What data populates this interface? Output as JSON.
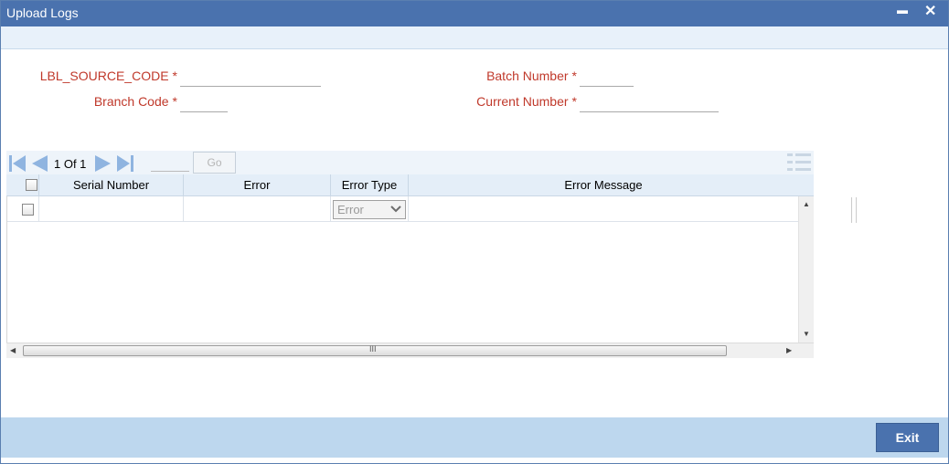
{
  "window": {
    "title": "Upload Logs",
    "minimize_glyph": "▬",
    "close_glyph": "✕"
  },
  "form": {
    "source_code_label": "LBL_SOURCE_CODE",
    "branch_code_label": "Branch Code",
    "batch_number_label": "Batch Number",
    "current_number_label": "Current Number",
    "required_mark": "*",
    "source_code_value": "",
    "branch_code_value": "",
    "batch_number_value": "",
    "current_number_value": ""
  },
  "grid": {
    "pager_text": "1 Of 1",
    "page_input_value": "",
    "go_label": "Go",
    "columns": [
      "Serial Number",
      "Error",
      "Error Type",
      "Error Message"
    ],
    "rows": [
      {
        "serial_number": "",
        "error": "",
        "error_type": "Error",
        "error_message": ""
      }
    ],
    "scroll_grip": "III"
  },
  "footer": {
    "exit_label": "Exit"
  },
  "colors": {
    "titlebar": "#4a72ae",
    "label_red": "#c0392b",
    "footer": "#bdd7ee",
    "nav_icon": "#8fb4e0"
  },
  "icons": [
    "first-page-icon",
    "prev-page-icon",
    "next-page-icon",
    "last-page-icon",
    "list-view-icon",
    "chevron-down-icon"
  ]
}
